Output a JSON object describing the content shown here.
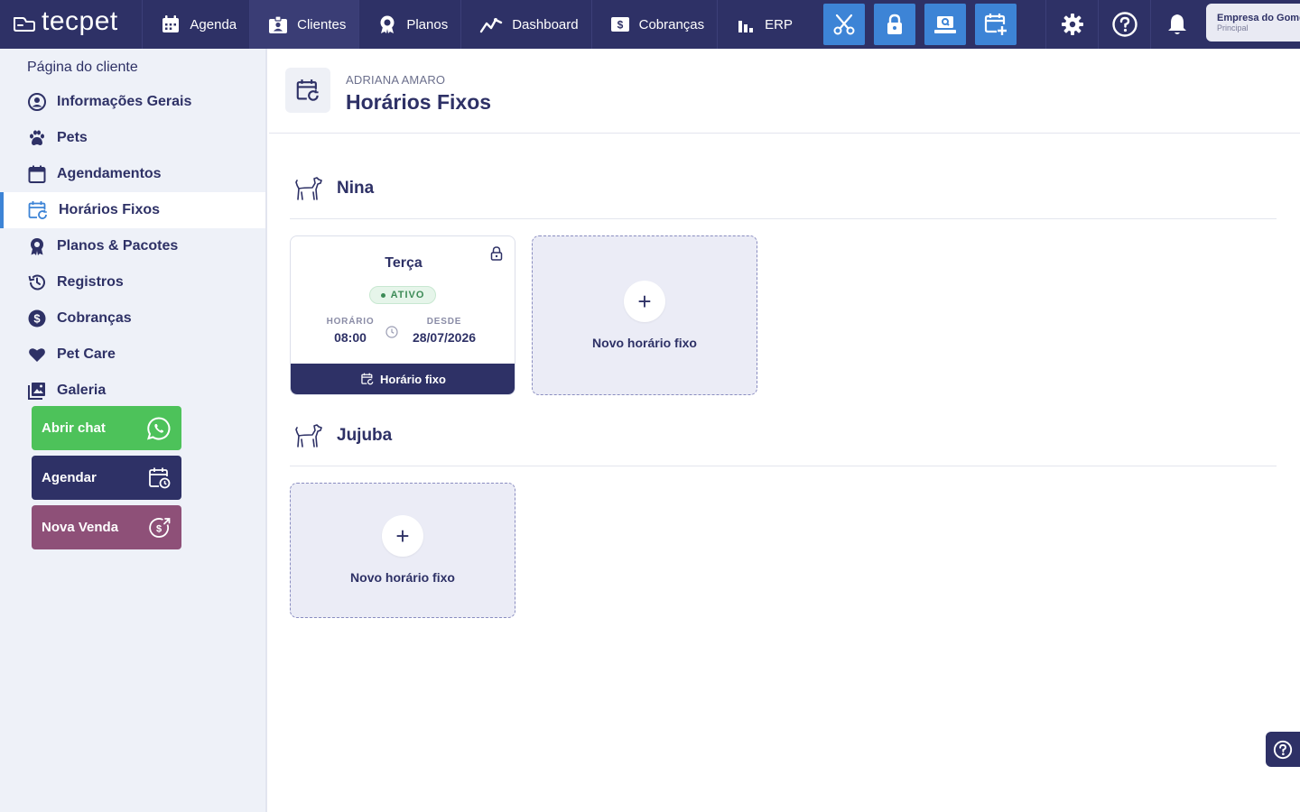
{
  "brand": {
    "logo_text": "tecpet"
  },
  "nav": {
    "items": [
      {
        "label": "Agenda",
        "icon": "calendar-icon"
      },
      {
        "label": "Clientes",
        "icon": "id-badge-icon"
      },
      {
        "label": "Planos",
        "icon": "award-icon"
      },
      {
        "label": "Dashboard",
        "icon": "chart-line-icon"
      },
      {
        "label": "Cobranças",
        "icon": "dollar-bill-icon"
      },
      {
        "label": "ERP",
        "icon": "bar-chart-icon"
      }
    ],
    "tools": [
      "scissors-icon",
      "lock-icon",
      "cash-register-icon",
      "calendar-plus-icon"
    ],
    "company": {
      "name": "Empresa do Gomes",
      "subtitle": "Principal"
    }
  },
  "sidebar": {
    "title": "Página do cliente",
    "items": [
      {
        "label": "Informações Gerais",
        "icon": "user-circle-icon"
      },
      {
        "label": "Pets",
        "icon": "paw-icon"
      },
      {
        "label": "Agendamentos",
        "icon": "calendar-icon"
      },
      {
        "label": "Horários Fixos",
        "icon": "calendar-repeat-icon"
      },
      {
        "label": "Planos & Pacotes",
        "icon": "award-icon"
      },
      {
        "label": "Registros",
        "icon": "history-icon"
      },
      {
        "label": "Cobranças",
        "icon": "dollar-circle-icon"
      },
      {
        "label": "Pet Care",
        "icon": "heart-icon"
      },
      {
        "label": "Galeria",
        "icon": "gallery-icon"
      }
    ],
    "actions": {
      "chat": "Abrir chat",
      "schedule": "Agendar",
      "sale": "Nova Venda"
    }
  },
  "header": {
    "subtitle": "ADRIANA AMARO",
    "title": "Horários Fixos"
  },
  "pets": [
    {
      "name": "Nina",
      "schedule": {
        "day": "Terça",
        "status": "ATIVO",
        "time_label": "HORÁRIO",
        "time": "08:00",
        "since_label": "DESDE",
        "since": "28/07/2026",
        "footer": "Horário fixo"
      },
      "add_label": "Novo horário fixo"
    },
    {
      "name": "Jujuba",
      "add_label": "Novo horário fixo"
    }
  ],
  "colors": {
    "navy": "#2e3166",
    "accent_blue": "#3d84d6",
    "whatsapp_green": "#4dc25a",
    "sale_purple": "#8e5078",
    "active_green": "#3d8b57"
  }
}
